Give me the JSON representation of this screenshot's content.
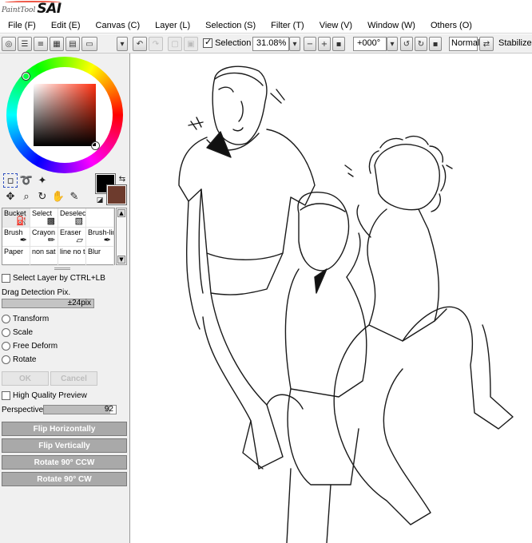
{
  "app": {
    "logo_small": "PaintTool",
    "logo_big": "SAI"
  },
  "menu": [
    "File (F)",
    "Edit (E)",
    "Canvas (C)",
    "Layer (L)",
    "Selection (S)",
    "Filter (T)",
    "View (V)",
    "Window (W)",
    "Others (O)"
  ],
  "toolbar": {
    "selection_label": "Selection",
    "selection_checked": true,
    "zoom": "31.08%",
    "rotation": "+000°",
    "blend_mode": "Normal",
    "stabilizer_label": "Stabilizer"
  },
  "color": {
    "foreground": "#000000",
    "background": "#6d3b2d"
  },
  "brushes": [
    {
      "name": "Bucket",
      "icon": "bucket-icon"
    },
    {
      "name": "Select",
      "icon": "select-icon"
    },
    {
      "name": "Deselect",
      "icon": "deselect-icon"
    },
    {
      "name": "",
      "icon": ""
    },
    {
      "name": "Brush",
      "icon": "brush-icon"
    },
    {
      "name": "Crayon",
      "icon": "crayon-icon"
    },
    {
      "name": "Eraser",
      "icon": "eraser-icon"
    },
    {
      "name": "Brush-lin",
      "icon": "brush-line-icon"
    },
    {
      "name": "Paper",
      "icon": "paper-icon"
    },
    {
      "name": "non sat",
      "icon": "pen-icon"
    },
    {
      "name": "line no te",
      "icon": "pen-icon"
    },
    {
      "name": "Blur",
      "icon": "blur-icon"
    }
  ],
  "options": {
    "select_layer_ctrl": "Select Layer by CTRL+LB",
    "drag_detection_label": "Drag Detection Pix.",
    "drag_detection_value": "±24pix",
    "transform": "Transform",
    "scale": "Scale",
    "free_deform": "Free Deform",
    "rotate": "Rotate",
    "ok": "OK",
    "cancel": "Cancel",
    "high_quality_preview": "High Quality Preview",
    "perspective_label": "Perspective",
    "perspective_value": "92",
    "flip_h": "Flip Horizontally",
    "flip_v": "Flip Vertically",
    "rotate_ccw": "Rotate 90° CCW",
    "rotate_cw": "Rotate 90° CW"
  }
}
